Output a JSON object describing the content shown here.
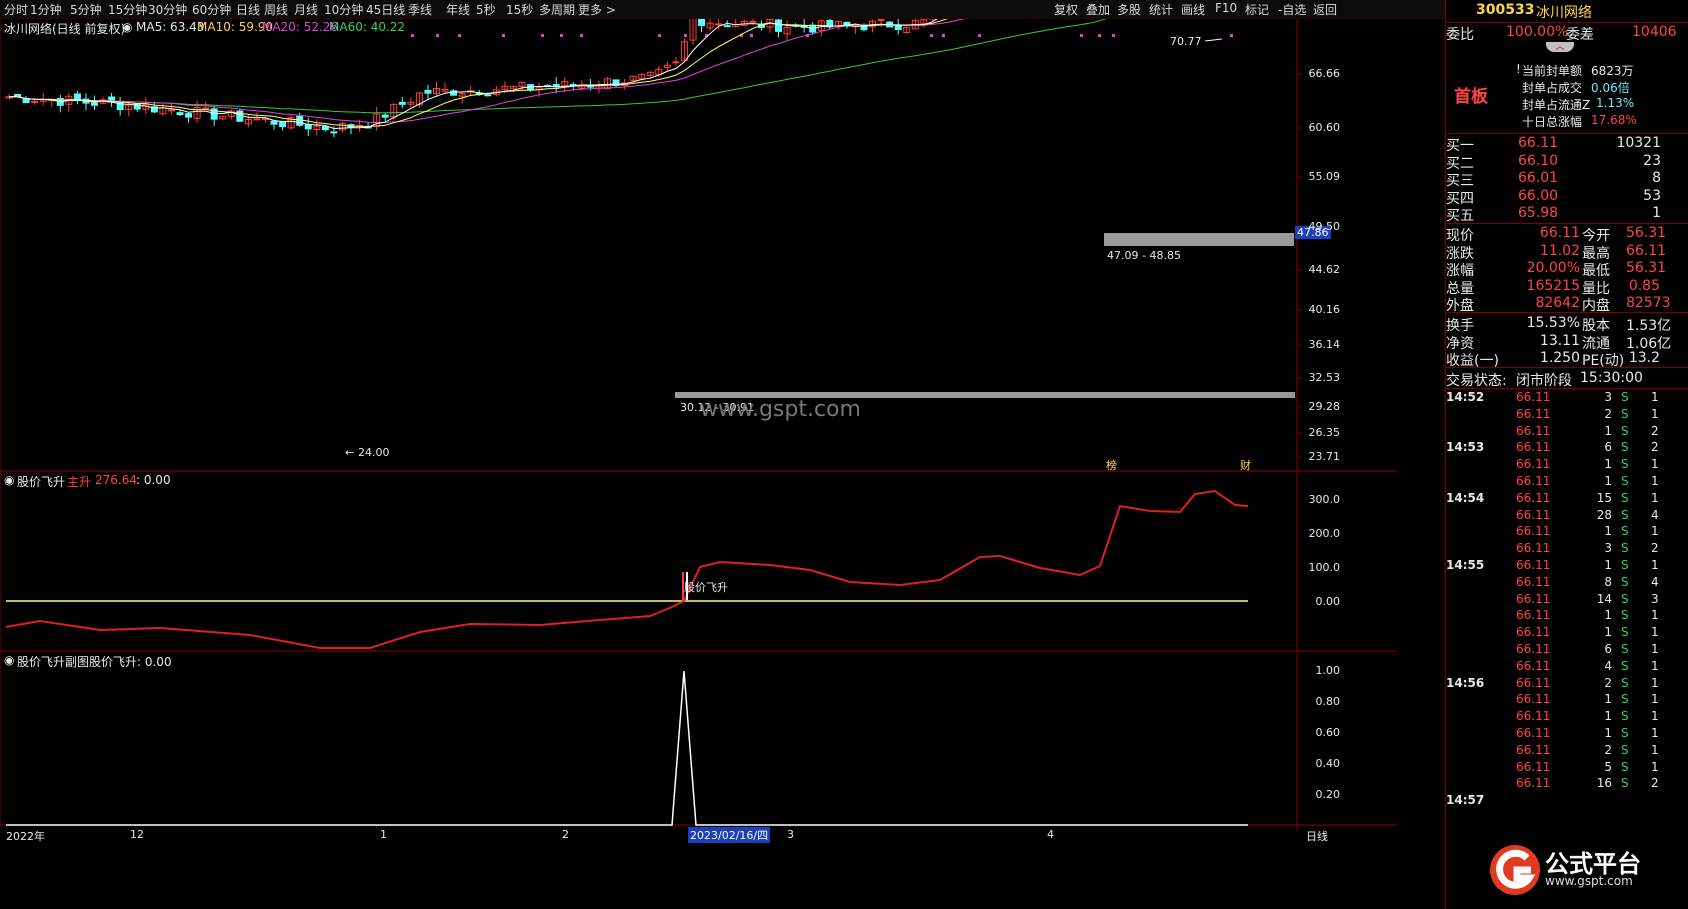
{
  "toolbar": {
    "left_items": [
      "分时",
      "1分钟",
      "5分钟",
      "15分钟",
      "30分钟",
      "60分钟",
      "日线",
      "周线",
      "月线",
      "10分钟",
      "45日线",
      "季线",
      "年线",
      "5秒",
      "15秒",
      "多周期",
      "更多 >"
    ],
    "right_items": [
      "复权",
      "叠加",
      "多股",
      "统计",
      "画线",
      "F10",
      "标记",
      "-自选",
      "返回"
    ]
  },
  "main_chart": {
    "stock_title": "冰川网络(日线 前复权)",
    "ma5": "MA5: 63.43",
    "ma10": "MA10: 59.90",
    "ma20": "MA20: 52.26",
    "ma60": "MA60: 40.22",
    "price_axis": [
      "66.66",
      "60.60",
      "55.09",
      "49.50",
      "44.62",
      "40.16",
      "36.14",
      "32.53",
      "29.28",
      "26.35",
      "23.71"
    ],
    "current_price_tag": "47.86",
    "high_marker": "70.77",
    "low_marker": "24.00",
    "zone_upper_label": "47.09 - 48.85",
    "zone_lower_label": "30.12 - 30.91",
    "watermark": "www.gspt.com",
    "event_tag_1": "榜",
    "event_tag_2": "财",
    "colors": {
      "up": "#ff3b3b",
      "down": "#54ffff",
      "ma5": "#ffffff",
      "ma10": "#ffff66",
      "ma20": "#e040e0",
      "ma60": "#33cc33"
    }
  },
  "indicator1": {
    "title": "股价飞升",
    "main_label": "主升",
    "main_value": "276.64",
    "zero_value": ": 0.00",
    "signal_text": "股价飞升",
    "axis": [
      "300.0",
      "200.0",
      "100.0",
      "0.00"
    ]
  },
  "indicator2": {
    "title": "股价飞升副图",
    "value_label": "股价飞升: 0.00",
    "axis": [
      "1.00",
      "0.80",
      "0.60",
      "0.40",
      "0.20"
    ]
  },
  "date_axis": {
    "labels": [
      "2022年",
      "12",
      "1",
      "2",
      "3",
      "4"
    ],
    "highlight": "2023/02/16/四",
    "period": "日线"
  },
  "panel": {
    "code": "300533",
    "name": "冰川网络",
    "weibi_label": "委比",
    "weibi_value": "100.00%",
    "weicha_label": "委差",
    "weicha_value": "10406",
    "board_tag": "首板",
    "seal_amount_label": "当前封单额",
    "seal_amount_value": "6823万",
    "seal_trade_label": "封单占成交",
    "seal_trade_value": "0.06倍",
    "seal_float_label": "封单占流通Z",
    "seal_float_value": "1.13%",
    "ten_day_label": "十日总涨幅",
    "ten_day_value": "17.68%",
    "bids": [
      {
        "label": "买一",
        "price": "66.11",
        "vol": "10321"
      },
      {
        "label": "买二",
        "price": "66.10",
        "vol": "23"
      },
      {
        "label": "买三",
        "price": "66.01",
        "vol": "8"
      },
      {
        "label": "买四",
        "price": "66.00",
        "vol": "53"
      },
      {
        "label": "买五",
        "price": "65.98",
        "vol": "1"
      }
    ],
    "stats": [
      {
        "l1": "现价",
        "v1": "66.11",
        "l2": "今开",
        "v2": "56.31"
      },
      {
        "l1": "涨跌",
        "v1": "11.02",
        "l2": "最高",
        "v2": "66.11"
      },
      {
        "l1": "涨幅",
        "v1": "20.00%",
        "l2": "最低",
        "v2": "56.31"
      },
      {
        "l1": "总量",
        "v1": "165215",
        "l2": "量比",
        "v2": "0.85"
      },
      {
        "l1": "外盘",
        "v1": "82642",
        "l2": "内盘",
        "v2": "82573"
      }
    ],
    "stats2": [
      {
        "l1": "换手",
        "v1": "15.53%",
        "l2": "股本",
        "v2": "1.53亿"
      },
      {
        "l1": "净资",
        "v1": "13.11",
        "l2": "流通",
        "v2": "1.06亿"
      },
      {
        "l1": "收益(一)",
        "v1": "1.250",
        "l2": "PE(动)",
        "v2": "13.2"
      }
    ],
    "trade_status_label": "交易状态:",
    "trade_status_value": "闭市阶段",
    "trade_status_time": "15:30:00",
    "ticks": [
      {
        "time": "14:52",
        "price": "66.11",
        "vol": "3",
        "bs": "S",
        "n": "1"
      },
      {
        "time": "",
        "price": "66.11",
        "vol": "2",
        "bs": "S",
        "n": "1"
      },
      {
        "time": "",
        "price": "66.11",
        "vol": "1",
        "bs": "S",
        "n": "2"
      },
      {
        "time": "14:53",
        "price": "66.11",
        "vol": "6",
        "bs": "S",
        "n": "2"
      },
      {
        "time": "",
        "price": "66.11",
        "vol": "1",
        "bs": "S",
        "n": "1"
      },
      {
        "time": "",
        "price": "66.11",
        "vol": "1",
        "bs": "S",
        "n": "1"
      },
      {
        "time": "14:54",
        "price": "66.11",
        "vol": "15",
        "bs": "S",
        "n": "1"
      },
      {
        "time": "",
        "price": "66.11",
        "vol": "28",
        "bs": "S",
        "n": "4"
      },
      {
        "time": "",
        "price": "66.11",
        "vol": "1",
        "bs": "S",
        "n": "1"
      },
      {
        "time": "",
        "price": "66.11",
        "vol": "3",
        "bs": "S",
        "n": "2"
      },
      {
        "time": "14:55",
        "price": "66.11",
        "vol": "1",
        "bs": "S",
        "n": "1"
      },
      {
        "time": "",
        "price": "66.11",
        "vol": "8",
        "bs": "S",
        "n": "4"
      },
      {
        "time": "",
        "price": "66.11",
        "vol": "14",
        "bs": "S",
        "n": "3"
      },
      {
        "time": "",
        "price": "66.11",
        "vol": "1",
        "bs": "S",
        "n": "1"
      },
      {
        "time": "",
        "price": "66.11",
        "vol": "1",
        "bs": "S",
        "n": "1"
      },
      {
        "time": "",
        "price": "66.11",
        "vol": "6",
        "bs": "S",
        "n": "1"
      },
      {
        "time": "",
        "price": "66.11",
        "vol": "4",
        "bs": "S",
        "n": "1"
      },
      {
        "time": "14:56",
        "price": "66.11",
        "vol": "2",
        "bs": "S",
        "n": "1"
      },
      {
        "time": "",
        "price": "66.11",
        "vol": "1",
        "bs": "S",
        "n": "1"
      },
      {
        "time": "",
        "price": "66.11",
        "vol": "1",
        "bs": "S",
        "n": "1"
      },
      {
        "time": "",
        "price": "66.11",
        "vol": "1",
        "bs": "S",
        "n": "1"
      },
      {
        "time": "",
        "price": "66.11",
        "vol": "2",
        "bs": "S",
        "n": "1"
      },
      {
        "time": "",
        "price": "66.11",
        "vol": "5",
        "bs": "S",
        "n": "1"
      },
      {
        "time": "",
        "price": "66.11",
        "vol": "16",
        "bs": "S",
        "n": "2"
      },
      {
        "time": "14:57",
        "price": "",
        "vol": "",
        "bs": "",
        "n": ""
      }
    ],
    "logo_text": "公式平台",
    "logo_url": "www.gspt.com"
  }
}
